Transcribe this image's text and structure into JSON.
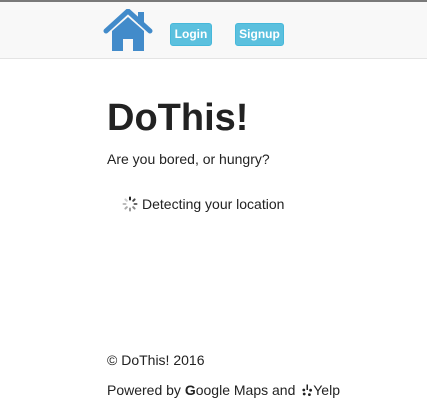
{
  "navbar": {
    "home_icon": "home-icon",
    "login_label": "Login",
    "signup_label": "Signup",
    "accent_color": "#5bc0de",
    "home_icon_color": "#428bca"
  },
  "main": {
    "title": "DoThis!",
    "tagline": "Are you bored, or hungry?",
    "status_icon": "loading-spinner-icon",
    "status_text": "Detecting your location"
  },
  "footer": {
    "copyright": "© DoThis! 2016",
    "powered_prefix": "Powered by",
    "google_letter": "G",
    "google_rest": "oogle",
    "maps_and": "Maps and",
    "yelp_icon": "yelp-icon",
    "yelp_label": "Yelp"
  }
}
